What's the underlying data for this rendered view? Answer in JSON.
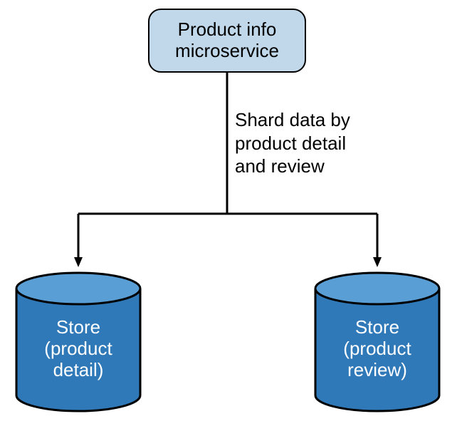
{
  "topBox": {
    "line1": "Product info",
    "line2": "microservice"
  },
  "edgeLabel": {
    "line1": "Shard data by",
    "line2": "product detail",
    "line3": "and review"
  },
  "leftCyl": {
    "line1": "Store",
    "line2": "(product",
    "line3": "detail)"
  },
  "rightCyl": {
    "line1": "Store",
    "line2": "(product",
    "line3": "review)"
  },
  "colors": {
    "boxFill": "#c0d8ea",
    "cylFill": "#3079b8",
    "cylTop": "#5a9ed6",
    "stroke": "#000"
  }
}
